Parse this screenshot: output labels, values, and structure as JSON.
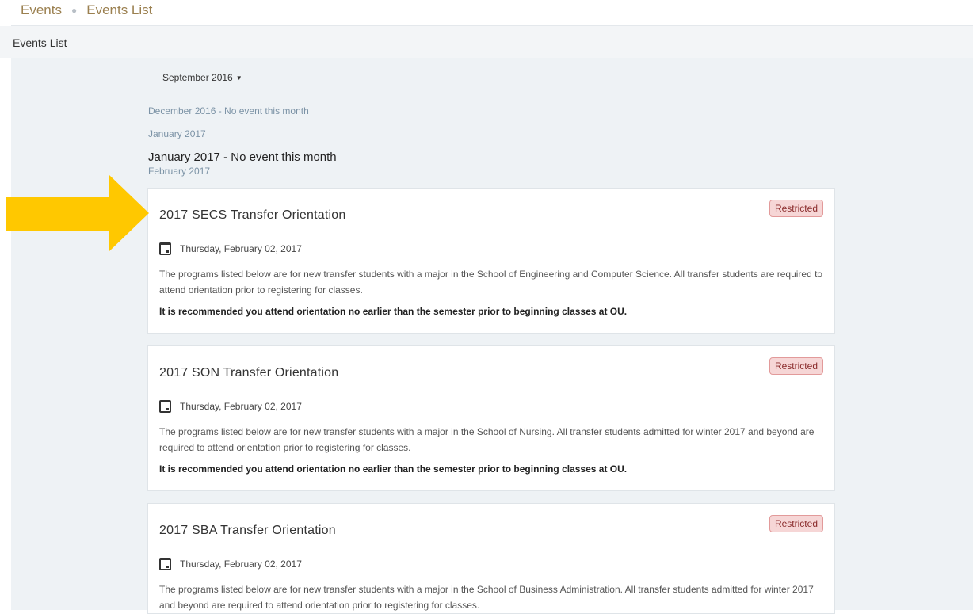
{
  "breadcrumb": {
    "items": [
      "Events",
      "Events List"
    ]
  },
  "page_title": "Events List",
  "month_selector": {
    "value": "September 2016"
  },
  "months": [
    "December 2016 - No event this month",
    "January 2017",
    "January 2017 - No event this month",
    "February 2017"
  ],
  "colors": {
    "accent": "#ffc800",
    "badge_bg": "#f6d6d6",
    "link": "#9b8050"
  },
  "icons": {
    "date": "calendar-icon",
    "pointer": "arrow-right-icon"
  },
  "events": [
    {
      "title": "2017 SECS Transfer Orientation",
      "badge": "Restricted",
      "date": "Thursday, February 02, 2017",
      "description": "The programs listed below are for new transfer students with a major in the School of Engineering and Computer Science. All transfer students are required to attend orientation prior to registering for classes.",
      "note": "It is recommended you attend orientation no earlier than the semester prior to beginning classes at OU."
    },
    {
      "title": "2017 SON Transfer Orientation",
      "badge": "Restricted",
      "date": "Thursday, February 02, 2017",
      "description": "The programs listed below are for new transfer students with a major in the School of Nursing. All transfer students admitted for winter 2017 and beyond are required to attend orientation prior to registering for classes.",
      "note": "It is recommended you attend orientation no earlier than the semester prior to beginning classes at OU."
    },
    {
      "title": "2017 SBA Transfer Orientation",
      "badge": "Restricted",
      "date": "Thursday, February 02, 2017",
      "description": "The programs listed below are for new transfer students with a major in the School of Business Administration. All transfer students admitted for winter 2017 and beyond are required to attend orientation prior to registering for classes."
    }
  ]
}
